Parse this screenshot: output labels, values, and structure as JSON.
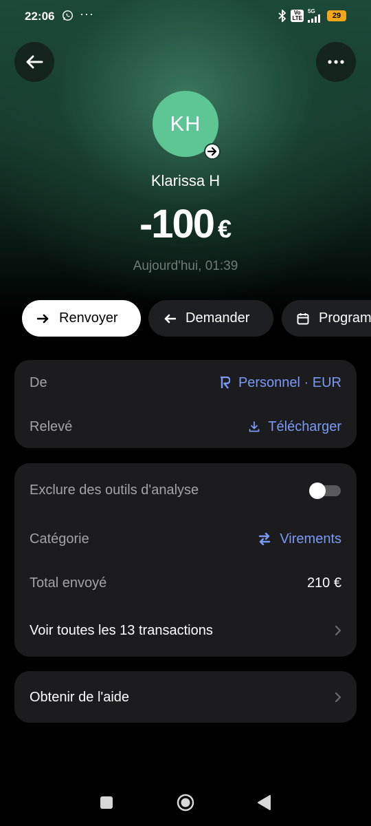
{
  "status_bar": {
    "time": "22:06",
    "more_indicator": "···",
    "volte_top": "Vo",
    "volte_bottom": "LTE",
    "network": "5G",
    "battery": "29"
  },
  "header": {
    "back_icon": "arrow-left-icon",
    "more_icon": "more-horizontal-icon"
  },
  "contact": {
    "initials": "KH",
    "name": "Klarissa H",
    "avatar_color": "#5ec694"
  },
  "transaction": {
    "amount": "-100",
    "currency": "€",
    "date": "Aujourd'hui, 01:39"
  },
  "actions": [
    {
      "label": "Renvoyer",
      "icon": "arrow-right-icon"
    },
    {
      "label": "Demander",
      "icon": "arrow-left-icon"
    },
    {
      "label": "Programmer",
      "icon": "calendar-icon"
    }
  ],
  "account_card": {
    "from_label": "De",
    "from_value": "Personnel · EUR",
    "statement_label": "Relevé",
    "statement_value": "Télécharger"
  },
  "details_card": {
    "exclude_label": "Exclure des outils d'analyse",
    "exclude_enabled": false,
    "category_label": "Catégorie",
    "category_value": "Virements",
    "total_label": "Total envoyé",
    "total_value": "210 €",
    "all_transactions_label": "Voir toutes les 13 transactions"
  },
  "help_card": {
    "label": "Obtenir de l'aide"
  },
  "colors": {
    "accent_link": "#7a9af5",
    "card_bg": "#1c1c1e",
    "hero_green": "#1d4a39"
  }
}
